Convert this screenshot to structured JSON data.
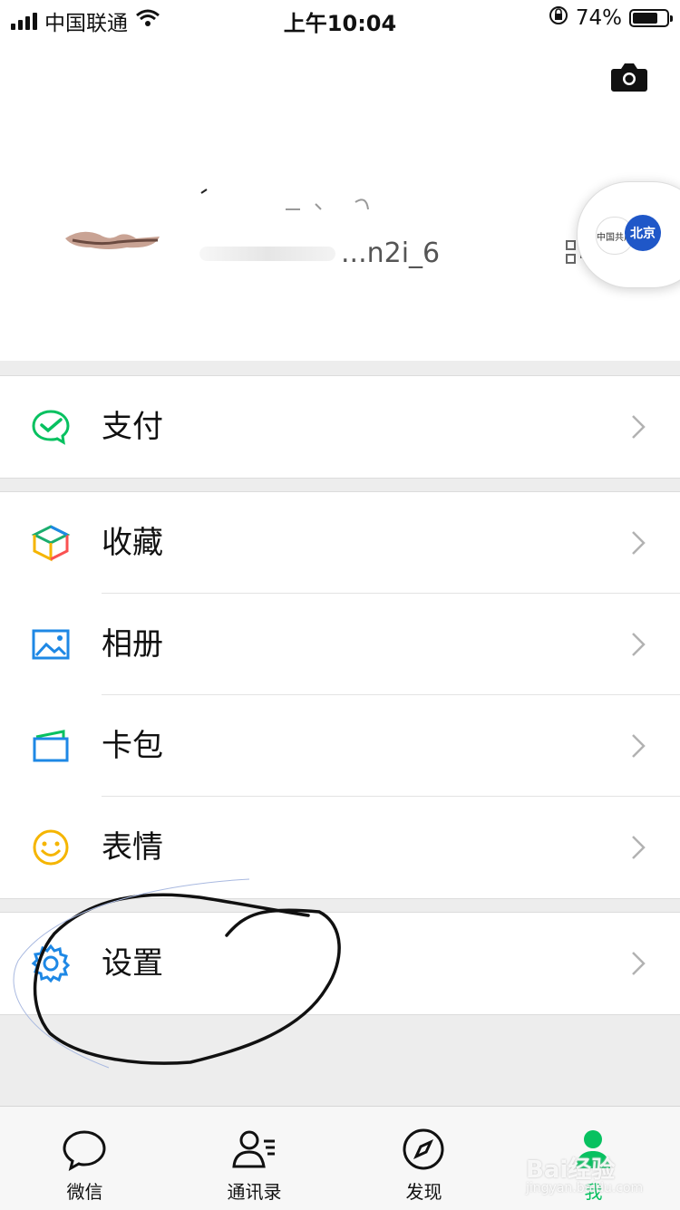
{
  "status_bar": {
    "carrier": "中国联通",
    "time": "上午10:04",
    "battery_percent": "74%",
    "battery_level": 0.74,
    "icons": [
      "signal-icon",
      "wifi-icon",
      "rotation-lock-icon",
      "battery-icon"
    ]
  },
  "profile": {
    "wechat_id_suffix": "...n2i_6",
    "camera_icon": "camera-icon",
    "qr_icon": "qr-code-icon",
    "floating_window": {
      "badge_left": "中国共产",
      "badge_right": "北京"
    }
  },
  "menu": {
    "pay": {
      "label": "支付",
      "icon": "wechat-pay-icon"
    },
    "favorites": {
      "label": "收藏",
      "icon": "favorites-cube-icon"
    },
    "album": {
      "label": "相册",
      "icon": "album-image-icon"
    },
    "cards": {
      "label": "卡包",
      "icon": "card-wallet-icon"
    },
    "stickers": {
      "label": "表情",
      "icon": "smiley-icon"
    },
    "settings": {
      "label": "设置",
      "icon": "gear-icon"
    }
  },
  "tabbar": {
    "tabs": [
      {
        "label": "微信",
        "icon": "chat-bubble-icon",
        "active": false
      },
      {
        "label": "通讯录",
        "icon": "contacts-icon",
        "active": false
      },
      {
        "label": "发现",
        "icon": "compass-icon",
        "active": false
      },
      {
        "label": "我",
        "icon": "person-icon",
        "active": true
      }
    ]
  },
  "colors": {
    "accent_green": "#07c160",
    "background": "#ededed"
  },
  "watermark": {
    "main": "Bai经验",
    "sub": "jingyan.baidu.com"
  }
}
